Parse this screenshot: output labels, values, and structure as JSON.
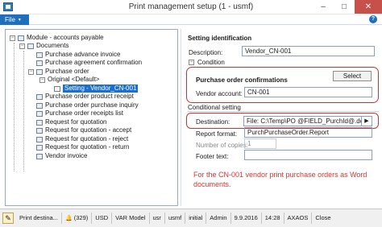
{
  "window": {
    "title": "Print management setup (1 - usmf)",
    "minimize_glyph": "–",
    "maximize_glyph": "□",
    "close_glyph": "✕"
  },
  "menu": {
    "file_label": "File",
    "file_arrow": "▼",
    "help_glyph": "?"
  },
  "tree": {
    "nodes": [
      {
        "label": "Module - accounts payable",
        "expander": "−"
      },
      {
        "label": "Documents",
        "expander": "−"
      },
      {
        "label": "Purchase advance invoice"
      },
      {
        "label": "Purchase agreement confirmation"
      },
      {
        "label": "Purchase order",
        "expander": "−"
      },
      {
        "label": "Original <Default>",
        "expander": "−"
      },
      {
        "label": "Setting - Vendor_CN-001"
      },
      {
        "label": "Purchase order product receipt"
      },
      {
        "label": "Purchase order purchase inquiry"
      },
      {
        "label": "Purchase order receipts list"
      },
      {
        "label": "Request for quotation"
      },
      {
        "label": "Request for quotation - accept"
      },
      {
        "label": "Request for quotation - reject"
      },
      {
        "label": "Request for quotation - return"
      },
      {
        "label": "Vendor invoice"
      }
    ]
  },
  "identification": {
    "header": "Setting identification",
    "description_label": "Description:",
    "description_value": "Vendor_CN-001",
    "condition_label": "Condition",
    "condition_expander": "−"
  },
  "po_confirmations": {
    "header": "Purchase order confirmations",
    "select_label": "Select",
    "vendor_label": "Vendor account:",
    "vendor_value": "CN-001"
  },
  "conditional": {
    "header": "Conditional setting",
    "destination_label": "Destination:",
    "destination_value": "File: C:\\Temp\\PO @FIELD_PurchId@.docx",
    "destination_arrow": "▶",
    "report_label": "Report format:",
    "report_value": "PurchPurchaseOrder.Report",
    "copies_label": "Number of copies:",
    "copies_value": "1",
    "footer_label": "Footer text:",
    "footer_value": ""
  },
  "annotation": "For the CN-001 vendor print purchase orders as Word documents.",
  "statusbar": {
    "items": [
      "Print destina...",
      "(329)",
      "USD",
      "VAR Model",
      "usr",
      "usmf",
      "initial",
      "Admin",
      "9.9.2016",
      "14:28",
      "AXAOS",
      "Close"
    ],
    "pencil_glyph": "✎",
    "bell_glyph": "🔔"
  },
  "colors": {
    "accent": "#1f6fbf",
    "highlight": "#d62d2d",
    "annotation": "#e03030"
  }
}
